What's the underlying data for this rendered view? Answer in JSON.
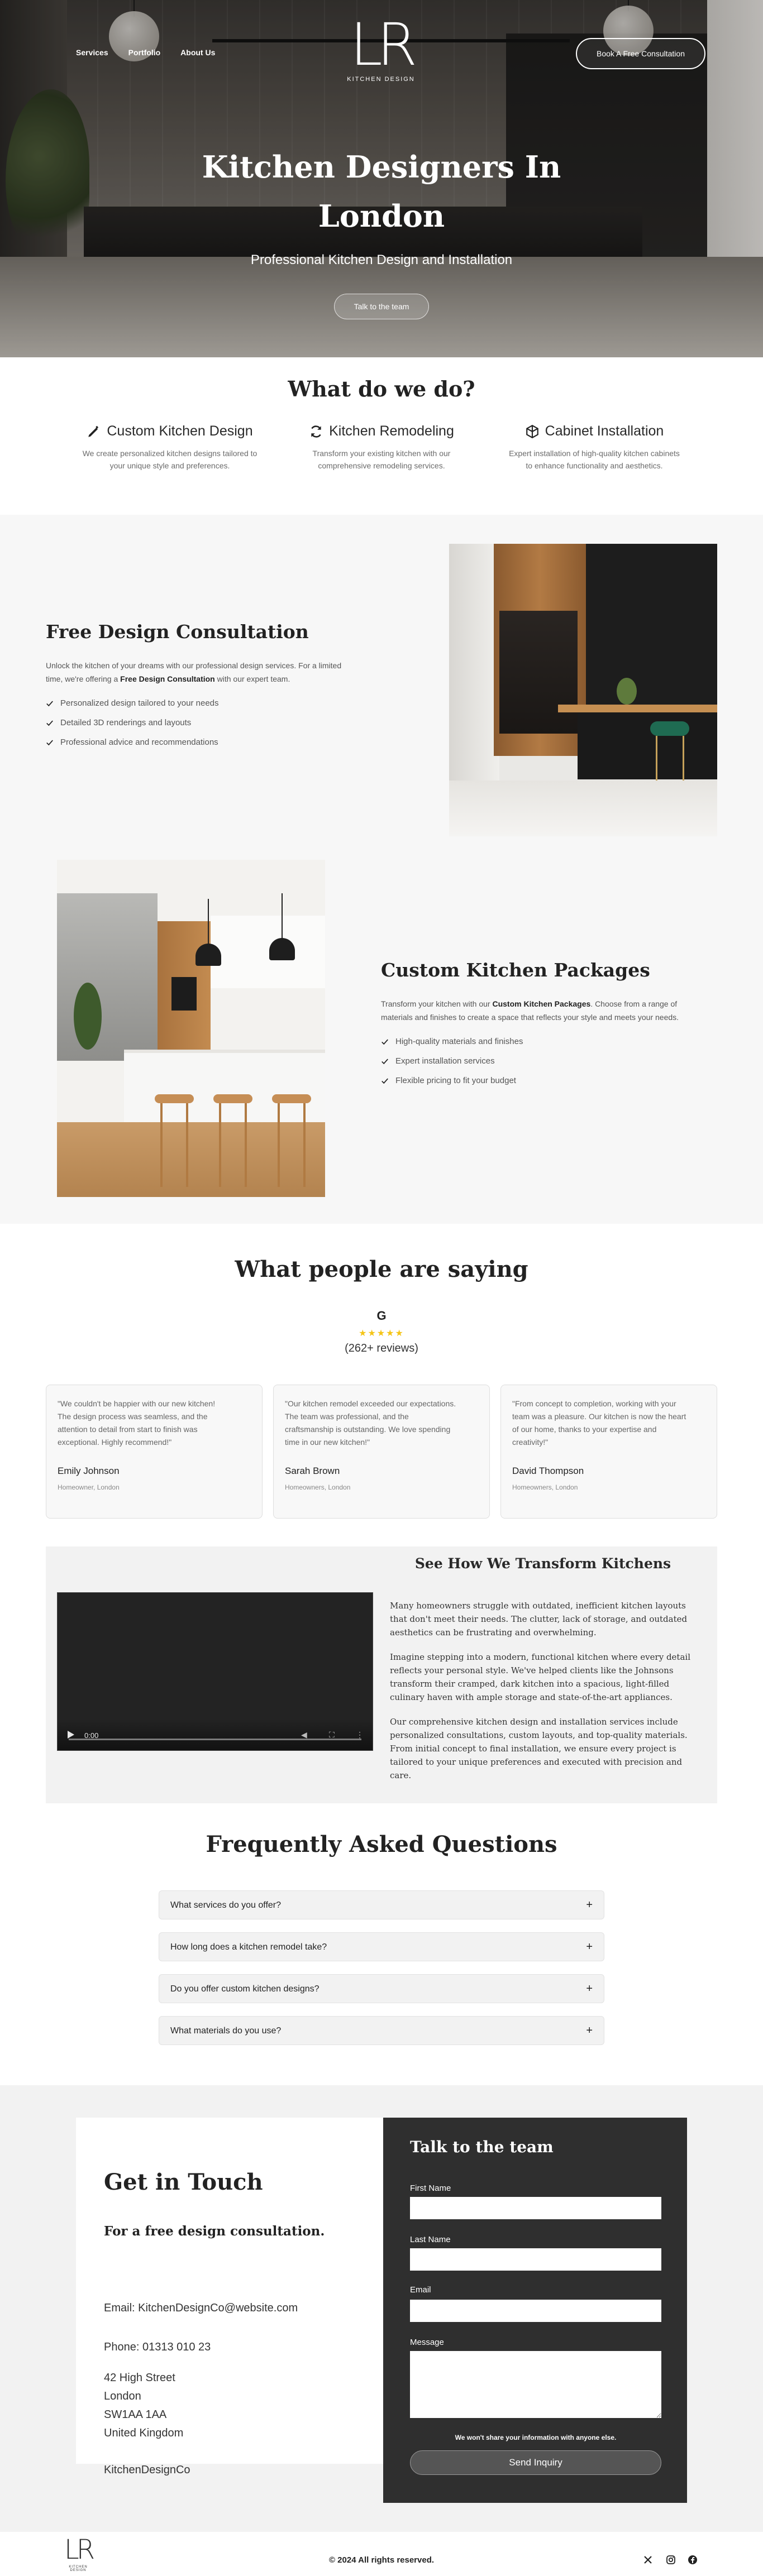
{
  "nav": {
    "links": [
      "Services",
      "Portfolio",
      "About Us"
    ],
    "cta": "Book A Free Consultation",
    "logo_mark": "LR",
    "logo_sub": "KITCHEN DESIGN"
  },
  "hero": {
    "title_line1": "Kitchen Designers In",
    "title_line2": "London",
    "subtitle": "Professional Kitchen Design and Installation",
    "button": "Talk to the team"
  },
  "services": {
    "title": "What do we do?",
    "items": [
      {
        "icon": "pencil-icon",
        "title": "Custom Kitchen Design",
        "text_line1": "We create personalized kitchen designs tailored to",
        "text_line2": "your unique style and preferences."
      },
      {
        "icon": "refresh-icon",
        "title": "Kitchen Remodeling",
        "text_line1": "Transform your existing kitchen with our",
        "text_line2": "comprehensive remodeling services."
      },
      {
        "icon": "cube-icon",
        "title": "Cabinet Installation",
        "text_line1": "Expert installation of high-quality kitchen cabinets",
        "text_line2": "to enhance functionality and aesthetics."
      }
    ]
  },
  "feature1": {
    "title": "Free Design Consultation",
    "text_line1": "Unlock the kitchen of your dreams with our professional design services. For a limited",
    "text_line2_pre": "time, we're offering a ",
    "text_line2_bold": "Free Design Consultation",
    "text_line2_post": " with our expert team.",
    "bullets": [
      "Personalized design tailored to your needs",
      "Detailed 3D renderings and layouts",
      "Professional advice and recommendations"
    ]
  },
  "feature2": {
    "title": "Custom Kitchen Packages",
    "text_line1_pre": "Transform your kitchen with our ",
    "text_line1_bold": "Custom Kitchen Packages",
    "text_line1_post": ". Choose from a range of",
    "text_line2": "materials and finishes to create a space that reflects your style and meets your needs.",
    "bullets": [
      "High-quality materials and finishes",
      "Expert installation services",
      "Flexible pricing to fit your budget"
    ]
  },
  "testimonials": {
    "title": "What people are saying",
    "google": "G",
    "stars": "★★★★★",
    "reviews": "(262+ reviews)",
    "cards": [
      {
        "q1": "\"We couldn't be happier with our new kitchen!",
        "q2": "The design process was seamless, and the",
        "q3": "attention to detail from start to finish was",
        "q4": "exceptional. Highly recommend!\"",
        "name": "Emily Johnson",
        "role": "Homeowner, London"
      },
      {
        "q1": "\"Our kitchen remodel exceeded our expectations.",
        "q2": "The team was professional, and the",
        "q3": "craftsmanship is outstanding. We love spending",
        "q4": "time in our new kitchen!\"",
        "name": "Sarah Brown",
        "role": "Homeowners, London"
      },
      {
        "q1": "\"From concept to completion, working with your",
        "q2": "team was a pleasure. Our kitchen is now the heart",
        "q3": "of our home, thanks to your expertise and",
        "q4": "creativity!\"",
        "name": "David Thompson",
        "role": "Homeowners, London"
      }
    ]
  },
  "video_section": {
    "title": "See How We Transform Kitchens",
    "time": "0:00",
    "p1": "Many homeowners struggle with outdated, inefficient kitchen layouts that don't meet their needs. The clutter, lack of storage, and outdated aesthetics can be frustrating and overwhelming.",
    "p2": "Imagine stepping into a modern, functional kitchen where every detail reflects your personal style. We've helped clients like the Johnsons transform their cramped, dark kitchen into a spacious, light-filled culinary haven with ample storage and state-of-the-art appliances.",
    "p3": "Our comprehensive kitchen design and installation services include personalized consultations, custom layouts, and top-quality materials. From initial concept to final installation, we ensure every project is tailored to your unique preferences and executed with precision and care."
  },
  "faq": {
    "title": "Frequently Asked Questions",
    "items": [
      "What services do you offer?",
      "How long does a kitchen remodel take?",
      "Do you offer custom kitchen designs?",
      "What materials do you use?"
    ],
    "plus": "+"
  },
  "contact": {
    "title": "Get in Touch",
    "subtitle": "For a free design consultation.",
    "email": "Email: KitchenDesignCo@website.com",
    "phone": "Phone: 01313 010 23",
    "address": [
      "42 High Street",
      "London",
      "SW1AA 1AA",
      "United Kingdom"
    ],
    "company": "KitchenDesignCo",
    "form": {
      "title": "Talk to the team",
      "first_name": "First Name",
      "last_name": "Last Name",
      "email": "Email",
      "message": "Message",
      "note": "We won't share your information with anyone else.",
      "submit": "Send Inquiry"
    }
  },
  "footer": {
    "logo_mark": "LR",
    "logo_sub": "KITCHEN DESIGN",
    "copyright": "© 2024 All rights reserved.",
    "social": [
      "x-icon",
      "instagram-icon",
      "facebook-icon"
    ]
  }
}
